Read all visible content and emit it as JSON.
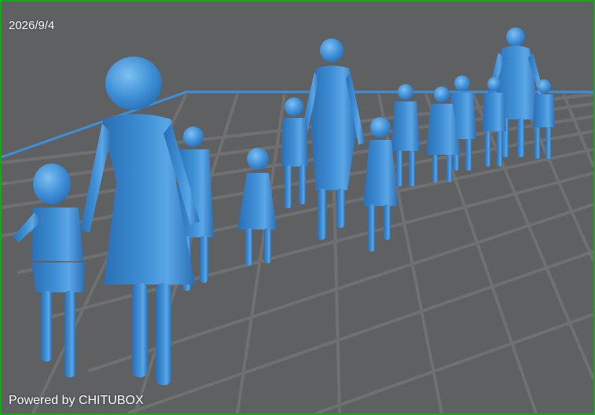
{
  "app": {
    "date": "2026/9/4",
    "powered_by": "Powered by CHITUBOX"
  },
  "colors": {
    "background": "#5f6062",
    "grid_line": "#6f7072",
    "grid_edge_accent": "#3f8fd6",
    "model_fill": "#3f8fd6",
    "model_shadow": "#2a6fb5",
    "model_highlight": "#7ec0f2",
    "border": "#1aa51a",
    "overlay_text": "#ffffff"
  },
  "scene": {
    "description_icon": "3d-model-figures",
    "grid_visible": true
  }
}
